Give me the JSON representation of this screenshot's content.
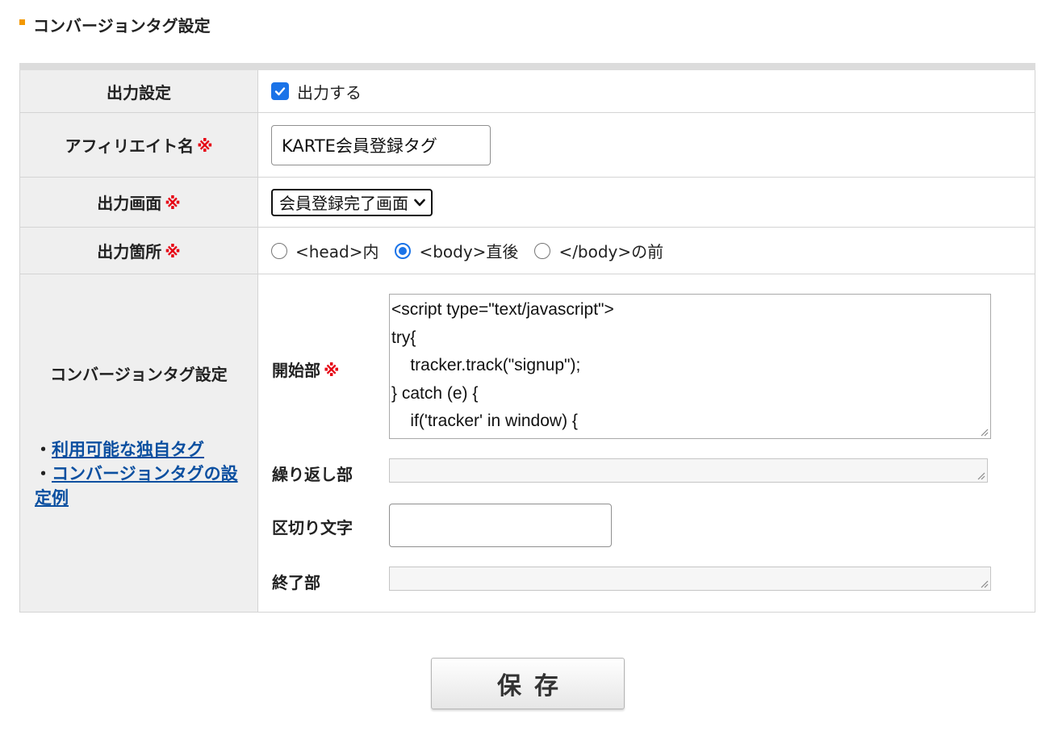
{
  "section": {
    "title": "コンバージョンタグ設定"
  },
  "required_mark": "※",
  "rows": {
    "output": {
      "label": "出力設定",
      "checkbox_label": "出力する",
      "checked": true
    },
    "affiliate": {
      "label": "アフィリエイト名",
      "value": "KARTE会員登録タグ"
    },
    "screen": {
      "label": "出力画面",
      "selected": "会員登録完了画面"
    },
    "place": {
      "label": "出力箇所",
      "options": [
        "<head>内",
        "<body>直後",
        "</body>の前"
      ],
      "selected_index": 1
    },
    "tag": {
      "label": "コンバージョンタグ設定",
      "bullet": "・",
      "links": [
        "利用可能な独自タグ",
        "コンバージョンタグの設定例"
      ],
      "start_label": "開始部",
      "start_code": "<script type=\"text/javascript\">\ntry{\n    tracker.track(\"signup\");\n} catch (e) {\n    if('tracker' in window) {",
      "repeat_label": "繰り返し部",
      "separator_label": "区切り文字",
      "end_label": "終了部"
    }
  },
  "save_button": "保存",
  "colors": {
    "accent": "#f39800",
    "required": "#e60012",
    "link": "#0b4fa0",
    "checkbox": "#1a73e8"
  }
}
